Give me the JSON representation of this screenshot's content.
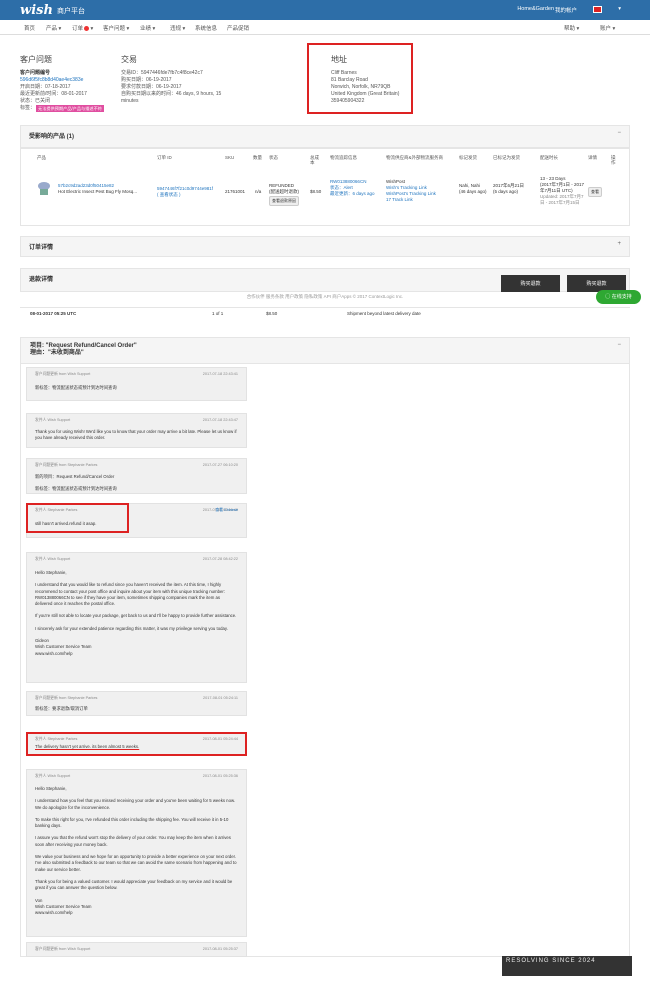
{
  "header": {
    "logo": "wish",
    "subtitle": "商户平台",
    "store": "Home&Garden",
    "account": "我的帐户",
    "flag_color": "#d22"
  },
  "nav": {
    "items": [
      "首页",
      "产品",
      "订单",
      "客户问题",
      "业绩",
      "违规",
      "系统信息",
      "产品促销"
    ],
    "orders_badge": "#e33",
    "right": [
      "帮助",
      "账户"
    ]
  },
  "customer": {
    "title": "客户问题",
    "ticket_label": "客户问题编号",
    "ticket_id": "596d6f5fc8b8d40ae4ec383e",
    "open_date": "开启日期：07-18-2017",
    "last_update": "最近更新前/时间：08-01-2017",
    "status": "状态：已关闭",
    "tag_label": "标签：",
    "tag": "无法提供预期产品/产品与描述不符"
  },
  "transaction": {
    "title": "交易",
    "txn_id": "交易ID：5947446fde7fb7c4f8ce42c7",
    "purchase_date": "购买日期：06-19-2017",
    "approve_date": "要求付款日期：06-19-2017",
    "elapsed": "自购买日期以来的时间：46 days, 9 hours, 15 minutes"
  },
  "address": {
    "title": "地址",
    "lines": [
      "Cliff Barnes",
      "81 Barclay Road",
      "Norwich, Norfolk, NR79QB",
      "United Kingdom (Great Britain)",
      "359405904322"
    ]
  },
  "products_panel": {
    "title": "受影响的产品 (1)"
  },
  "table": {
    "headers": [
      "产品",
      "订单 ID",
      "SKU",
      "数量",
      "状态",
      "总成本",
      "物流追踪信息",
      "物流供应商&外部物流服务商",
      "标记发货",
      "已标记为发货",
      "配送时长",
      "详情",
      "操作"
    ],
    "row": {
      "product_id": "57b2c9d2ad23d0f50415e82",
      "product_name": "Hot Electric Insect Pest Bug Fly Mosq...",
      "order_id": "5947446f7f21c0d9744e981f",
      "order_status": "( 查看状态 )",
      "sku": "21761001",
      "qty": "n/a",
      "state": "REFUNDED",
      "state_note": "(配送超时退款)",
      "state_btn": "查看退款原因",
      "cost": "$8.50",
      "tracking": "RW013880066CN",
      "tracking_status": "状态：Alert",
      "tracking_updated": "最近更新：6 days ago",
      "carrier": "WishPost",
      "carrier_link1": "Wish's Tracking Link",
      "carrier_link2": "WishPost's Tracking Link",
      "carrier_link3": "17 Track Link",
      "shipper": "Nahi, Nahi",
      "shipper_days": "(46 days ago)",
      "shipped": "2017年6月21日",
      "shipped_ago": "(5 days ago)",
      "delivery1": "13 - 23 Days",
      "delivery2": "(2017年7月1日 - 2017年7月11日 UTC)",
      "delivery3": "Updated: 2017年7月7日 - 2017年7月15日",
      "detail_btn": "查看"
    }
  },
  "order_panel": {
    "title": "订单详情"
  },
  "refund_panel": {
    "title": "退款详情",
    "btn1": "购买退款",
    "btn2": "购买退款"
  },
  "footer": {
    "text": "合作伙伴   服务条款   用户政策   隐私政策   API   商户Apps   © 2017 ContextLogic Inc.",
    "chat": "在线支持"
  },
  "refund_row": {
    "date": "08-01-2017 05:25 UTC",
    "qty": "1 of 1",
    "amount": "$8.50",
    "reason": "Shipment beyond latest delivery date"
  },
  "issue": {
    "line1": "项目: \"Request Refund/Cancel Order\"",
    "line2": "理由：\"未收到商品\""
  },
  "messages": [
    {
      "from": "客户问题更新 from Wish Support",
      "time": "2017-07-18 22:43:41",
      "body": [
        "新标签：物流配送状态或预计到达时间查询"
      ]
    },
    {
      "from": "发件人 Wish Support",
      "time": "2017-07-18 22:43:47",
      "body": [
        "Thank you for using Wish! We'd like you to know that your order may arrive a bit late. Please let us know if you have already received this order."
      ]
    },
    {
      "from": "客户问题更新 from Stephanie Parkes",
      "time": "2017-07-27 06:10:20",
      "body": [
        "新的项目：Request Refund/Cancel Order",
        "新标签：物流配送状态或预计到达时间查询"
      ]
    },
    {
      "from": "发件人 Stephanie Parkes",
      "time": "2017-07-27 06:16:40",
      "body": [
        "still hasn't arrived.refund it asap."
      ],
      "translate": "查看 Chinese"
    },
    {
      "from": "发件人 Wish Support",
      "time": "2017-07-28 08:42:22",
      "body": [
        "Hello Stephanie,",
        "I understand that you would like to refund since you haven't received the item. At this time, I highly recommend to contact your post office and inquire about your item with this unique tracking number: RW013880066CN to see if they have your item, sometimes shipping companies mark the item as delivered once it reaches the postal office.",
        "If you're still not able to locate your package, get back to us and I'll be happy to provide further assistance.",
        "I sincerely ask for your extended patience regarding this matter, it was my privilege serving you today.",
        "Gideon\nWish Customer Service Team\nwww.wish.com/help"
      ]
    },
    {
      "from": "客户问题更新 from Stephanie Parkes",
      "time": "2017-08-01 05:24:11",
      "body": [
        "新标签：要求退款/取消订单"
      ]
    },
    {
      "from": "发件人 Stephanie Parkes",
      "time": "2017-08-01 05:24:44",
      "body": [
        "The delivery hasn't yet arrive. its been almost 5 weeks."
      ]
    },
    {
      "from": "发件人 Wish Support",
      "time": "2017-08-01 05:25:36",
      "body": [
        "Hello Stephanie,",
        "I understand how you feel that you missed receiving your order and you've been waiting for 5 weeks now. We do apologize for the inconvenience.",
        "To make this right for you, I've refunded this order including the shipping fee. You will receive it in 5-10 banking days.",
        "I assure you that the refund won't stop the delivery of your order. You may keep the item when it arrives soon after receiving your money back.",
        "We value your business and we hope for an opportunity to provide a better experience on your next order. I've also submitted a feedback to our team so that we can avoid the same scenario from happening and to make our service better.",
        "Thank you for being a valued customer. I would appreciate your feedback on my service and it would be great if you can answer the question below.",
        "Von\nWish Customer Service Team\nwww.wish.com/help"
      ]
    },
    {
      "from": "客户问题更新 from Wish Support",
      "time": "2017-08-01 05:25:37",
      "body": []
    }
  ],
  "watermark": "RESOLVING SINCE 2024"
}
